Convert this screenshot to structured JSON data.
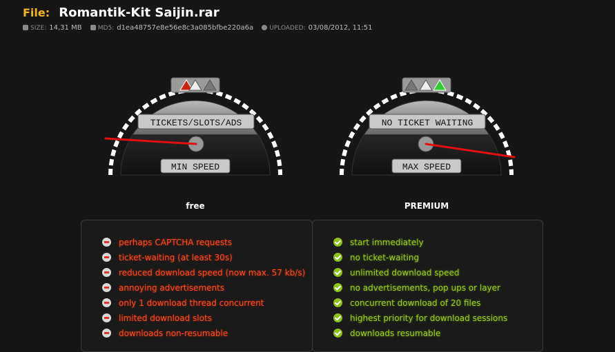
{
  "file": {
    "label": "File:",
    "name": "Romantik-Kit Saijin.rar"
  },
  "meta": {
    "size_key": "SIZE:",
    "size_val": "14,31 MB",
    "md5_key": "MD5:",
    "md5_val": "d1ea48757e8e56e8c3a085bfbe220a6a",
    "uploaded_key": "UPLOADED:",
    "uploaded_val": "03/08/2012, 11:51"
  },
  "gauges": {
    "free": {
      "top_label": "TICKETS/SLOTS/ADS",
      "bottom_label": "MIN SPEED",
      "plan": "free",
      "warning_icons": [
        "warning-red-icon",
        "warning-white-icon",
        "warning-grey-icon"
      ]
    },
    "premium": {
      "top_label": "NO TICKET WAITING",
      "bottom_label": "MAX SPEED",
      "plan": "PREMIUM",
      "warning_icons": [
        "warning-grey-icon",
        "warning-white-icon",
        "warning-green-icon"
      ]
    }
  },
  "free_list": [
    "perhaps CAPTCHA requests",
    "ticket-waiting (at least 30s)",
    "reduced download speed (now max. 57 kb/s)",
    "annoying advertisements",
    "only 1 download thread concurrent",
    "limited download slots",
    "downloads non-resumable"
  ],
  "premium_list": [
    "start immediately",
    "no ticket-waiting",
    "unlimited download speed",
    "no advertisements, pop ups or layer",
    "concurrent download of 20 files",
    "highest priority for download sessions",
    "downloads resumable"
  ],
  "colors": {
    "file_label": "#f0b41e",
    "needle": "#e01010",
    "free_text": "#ff4a1c",
    "premium_text": "#9bd11a"
  }
}
